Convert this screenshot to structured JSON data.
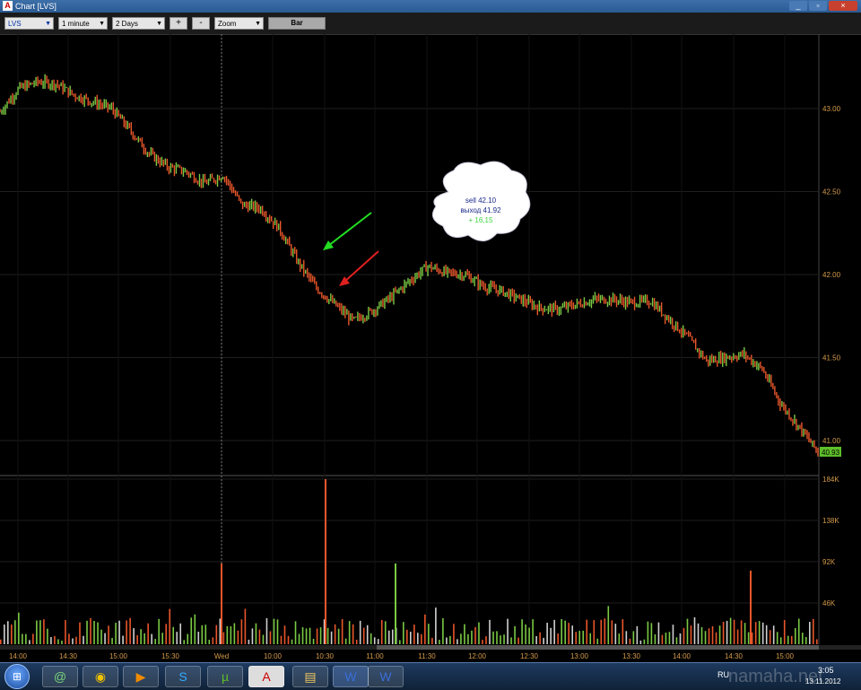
{
  "window": {
    "icon": "A",
    "title": "Chart [LVS]",
    "controls": [
      "_",
      "▫",
      "×"
    ]
  },
  "toolbar": {
    "symbol": "LVS",
    "interval": "1 minute",
    "period": "2 Days",
    "zoom_in": "+",
    "zoom_out": "-",
    "zoom": "Zoom",
    "type": "Bar"
  },
  "chart_data": {
    "type": "line",
    "symbol": "LVS",
    "price_axis": {
      "ticks": [
        "43.00",
        "42.50",
        "42.00",
        "41.50",
        "41.00"
      ],
      "values": [
        43.0,
        42.5,
        42.0,
        41.5,
        41.0
      ]
    },
    "last_price": "40.93",
    "volume_axis": {
      "ticks": [
        "184K",
        "138K",
        "92K",
        "46K"
      ],
      "values": [
        184000,
        138000,
        92000,
        46000
      ]
    },
    "time_ticks": [
      "14:00",
      "14:30",
      "15:00",
      "15:30",
      "Wed",
      "10:00",
      "10:30",
      "11:00",
      "11:30",
      "12:00",
      "12:30",
      "13:00",
      "13:30",
      "14:00",
      "14:30",
      "15:00"
    ],
    "session_break": "Wed",
    "price_series": {
      "x": [
        "14:00",
        "14:10",
        "14:20",
        "14:30",
        "14:40",
        "14:50",
        "15:00",
        "15:10",
        "15:20",
        "15:30",
        "15:40",
        "15:50",
        "16:00",
        "10:00",
        "10:10",
        "10:20",
        "10:30",
        "10:40",
        "10:50",
        "11:00",
        "11:10",
        "11:20",
        "11:30",
        "11:40",
        "11:50",
        "12:00",
        "12:10",
        "12:20",
        "12:30",
        "12:40",
        "12:50",
        "13:00",
        "13:10",
        "13:20",
        "13:30",
        "13:40",
        "13:50",
        "14:00",
        "14:10",
        "14:20",
        "14:30",
        "14:40",
        "14:50",
        "15:00",
        "15:10"
      ],
      "values": [
        42.98,
        43.12,
        43.16,
        43.15,
        43.08,
        43.04,
        43.0,
        42.87,
        42.73,
        42.65,
        42.62,
        42.55,
        42.6,
        42.42,
        42.4,
        42.28,
        42.08,
        41.92,
        41.82,
        41.72,
        41.78,
        41.86,
        41.96,
        42.05,
        42.01,
        42.0,
        41.93,
        41.9,
        41.85,
        41.8,
        41.79,
        41.82,
        41.85,
        41.85,
        41.83,
        41.84,
        41.73,
        41.62,
        41.48,
        41.5,
        41.52,
        41.43,
        41.22,
        41.08,
        40.93
      ]
    },
    "volume_spikes": [
      {
        "x": "15:54",
        "value": 90000
      },
      {
        "x": "10:33",
        "value": 184000
      },
      {
        "x": "11:10",
        "value": 90000
      },
      {
        "x": "14:40",
        "value": 82000
      }
    ],
    "annotations": {
      "entry_arrow": "green",
      "exit_arrow": "red",
      "note": [
        "sell 42.10",
        "выход 41.92",
        "+ 16,15"
      ]
    }
  },
  "taskbar": {
    "apps": [
      "mail-agent-icon",
      "chrome-icon",
      "media-player-icon",
      "skype-icon",
      "utorrent-icon",
      "app-a-icon",
      "folder-icon",
      "word-icon",
      "word-doc-icon"
    ],
    "lang": "RU",
    "clock": "3:05",
    "date": "13.11.2012",
    "watermark": "namaha.net"
  },
  "colors": {
    "up": "#7ac943",
    "down": "#e8562a",
    "grid": "#1e1e1e",
    "axis_text": "#d49a4a",
    "last_price_bg": "#5fbf2a"
  }
}
